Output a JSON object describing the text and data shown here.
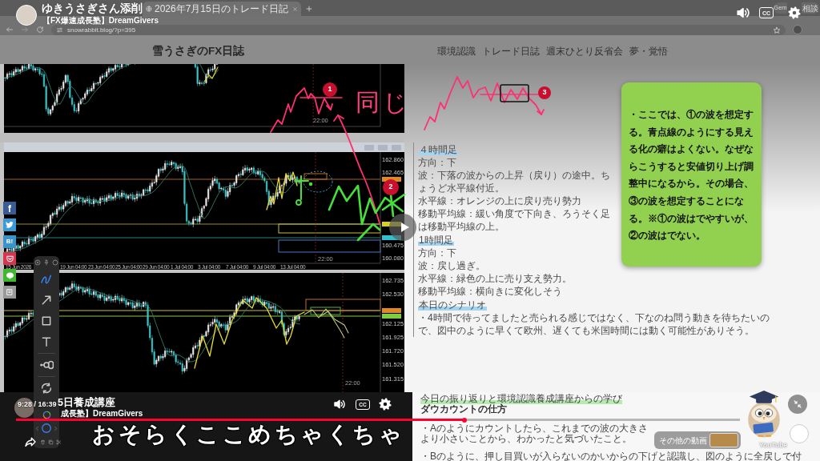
{
  "browser": {
    "tab_title": "2026年7月15日のトレード日記",
    "url": "snowrabbit.blog/?p=395",
    "assistant_button": {
      "visible_start": "Gem",
      "visible_end": "相談"
    }
  },
  "video_header": {
    "title": "ゆきうさぎさん添削",
    "channel": "【FX爆速成長塾】DreamGivers",
    "captions_label": "CC"
  },
  "blog_header": {
    "title": "雪うさぎのFX日誌",
    "nav": [
      {
        "label": "環境認識"
      },
      {
        "label": "トレード日誌"
      },
      {
        "label": "週末ひとり反省会"
      },
      {
        "label": "夢・覚悟"
      }
    ]
  },
  "charts": [
    {
      "time_label": "22:00"
    },
    {
      "time_label": "22:00",
      "date_labels": [
        "15 Jun 2026",
        "19 Jun 04:00",
        "23 Jun 04:00",
        "25 Jun 04:00",
        "29 Jun 04:00",
        "1 Jul 04:00",
        "3 Jul 04:00",
        "7 Jul 04:00",
        "9 Jul 04:00",
        "13 Jul 04:00"
      ],
      "price_labels": [
        "162.860",
        "162.465",
        "160.475",
        "160.080"
      ]
    },
    {
      "time_label": "22:00",
      "price_labels": [
        "162.735",
        "162.530",
        "162.125",
        "161.925",
        "161.720",
        "161.520",
        "161.315"
      ]
    }
  ],
  "share_buttons": [
    {
      "kind": "facebook",
      "label": "f"
    },
    {
      "kind": "twitter"
    },
    {
      "kind": "hatena",
      "label": "B!"
    },
    {
      "kind": "pocket"
    },
    {
      "kind": "line"
    },
    {
      "kind": "feedly"
    }
  ],
  "annotations": {
    "handwriting": "同じ",
    "markers": [
      {
        "label": "1"
      },
      {
        "label": "2"
      },
      {
        "label": "3"
      }
    ]
  },
  "note": {
    "text": "・ここでは、①の波を想定する。青点線のようにする見える化の癖はよくない。なぜならこうすると安値切り上げ調整中になるから。その場合、③の波を想定することになる。※①の波はでやすいが、②の波はでない。"
  },
  "article": {
    "blocks": [
      {
        "kind": "heading",
        "text": "４時間足"
      },
      {
        "kind": "line",
        "text": "方向：下"
      },
      {
        "kind": "line",
        "text": "波：下落の波からの上昇（戻り）の途中。ちょうど水平線付近。"
      },
      {
        "kind": "line",
        "text": "水平線：オレンジの上に戻り売り勢力"
      },
      {
        "kind": "line",
        "text": "移動平均線：緩い角度で下向き、ろうそく足は移動平均線の上。"
      },
      {
        "kind": "heading",
        "text": "1時間足"
      },
      {
        "kind": "line",
        "text": "方向：下"
      },
      {
        "kind": "line",
        "text": "波：戻し過ぎ。"
      },
      {
        "kind": "line",
        "text": "水平線：緑色の上に売り支え勢力。"
      },
      {
        "kind": "line",
        "text": "移動平均線：横向きに変化しそう"
      },
      {
        "kind": "heading",
        "text": "本日のシナリオ"
      },
      {
        "kind": "line",
        "text": "・4時間で待ってましたと売られる感じではなく、下なのね問う動きを待ちたいので、図中のように早くて欧州、遅くても米国時間には動く可能性がありそう。"
      }
    ]
  },
  "summary": {
    "heading": "今日の振り返りと環境認識養成講座からの学び",
    "subheading": "ダウカウントの仕方",
    "lines": [
      "・Aのようにカウントしたら、これまでの波の大きさより小さいことから、わかったと気づいたこと。",
      "・Bのように、押し目買いが入らないのかいからの下げと認識し、図のように全戻しで付"
    ]
  },
  "drawing_toolbar": {
    "tools": [
      {
        "kind": "pen",
        "selected": true
      },
      {
        "kind": "arrow",
        "selected": false
      },
      {
        "kind": "rectangle",
        "selected": false
      },
      {
        "kind": "text",
        "selected": false
      },
      {
        "kind": "stroke-width",
        "selected": false
      },
      {
        "kind": "rotate",
        "selected": false
      }
    ]
  },
  "player": {
    "time": "9:28 / 16:39",
    "title": "5日養成講座",
    "channel": "成長塾】DreamGivers",
    "captions_label": "CC",
    "progress": {
      "level": 0.62
    },
    "caption": "おそらくここめちゃくちゃ",
    "more_videos": "その他の動画",
    "brand": "YouTube"
  }
}
